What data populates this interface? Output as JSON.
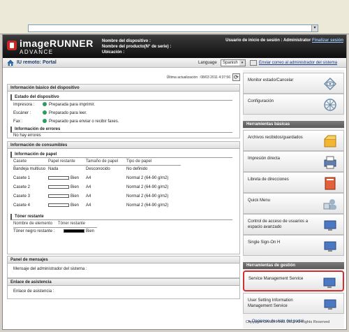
{
  "browser": {
    "address_value": "",
    "dropdown_icon": "chevron-down-icon"
  },
  "header": {
    "logo_line1": "imageRUNNER",
    "logo_line2": "ADVANCE",
    "device_name_label": "Nombre del dispositivo :",
    "product_name_label": "Nombre del producto(N° de serie) :",
    "location_label": "Ubicación :",
    "user_label": "Usuario de inicio de sesión : Administrator",
    "logout_link": "Finalizar sesión"
  },
  "toolbar": {
    "title": "IU remoto: Portal",
    "language_label": "Language",
    "language_value": "Spanish",
    "mail_link": "Enviar correo al administrador del sistema"
  },
  "main": {
    "last_update": "Última actualización : 08/03 2011 4:37:56",
    "basic_info": {
      "title": "Información básico del dispositivo",
      "status_title": "Estado del dispositivo",
      "status_rows": [
        {
          "name": "Impresora :",
          "value": "Preparada para imprimir."
        },
        {
          "name": "Escáner :",
          "value": "Preparado para leer."
        },
        {
          "name": "Fax :",
          "value": "Preparado para enviar o recibir faxes."
        }
      ],
      "errors_title": "Información de errores",
      "errors_value": "No hay errores"
    },
    "consumables": {
      "title": "Información de consumibles",
      "paper_title": "Información de papel",
      "paper_headers": [
        "Casete",
        "Papel restante",
        "Tamaño de papel",
        "Tipo de papel"
      ],
      "paper_rows": [
        {
          "cassette": "Bandeja multiuso",
          "remaining": "Nada",
          "size": "Desconocido",
          "type": "No definido"
        },
        {
          "cassette": "Casete 1",
          "remaining": "Bien",
          "size": "A4",
          "type": "Normal 2 (64-90 g/m2)"
        },
        {
          "cassette": "Casete 2",
          "remaining": "Bien",
          "size": "A4",
          "type": "Normal 2 (64-90 g/m2)"
        },
        {
          "cassette": "Casete 3",
          "remaining": "Bien",
          "size": "A4",
          "type": "Normal 2 (64-90 g/m2)"
        },
        {
          "cassette": "Casete 4",
          "remaining": "Bien",
          "size": "A4",
          "type": "Normal 2 (64-90 g/m2)"
        }
      ],
      "toner_title": "Tóner restante",
      "toner_headers": [
        "Nombre de elemento",
        "Tóner restante"
      ],
      "toner_row": {
        "name": "Tóner negro restante :",
        "value": "Bien"
      }
    },
    "messages": {
      "title": "Panel de mensajes",
      "label": "Mensaje del administrador del sistema :"
    },
    "support": {
      "title": "Enlace de asistencia",
      "label": "Enlace de asistencia :"
    }
  },
  "side": {
    "top_buttons": [
      {
        "label": "Monitor estado/Cancelar",
        "icon": "eye-icon"
      },
      {
        "label": "Configuración",
        "icon": "gear-icon"
      }
    ],
    "basic_tools_title": "Herramientas básicas",
    "basic_tools": [
      {
        "label": "Archivos recibidos/guardados",
        "icon": "box-icon"
      },
      {
        "label": "Impresión directa",
        "icon": "printer-icon"
      },
      {
        "label": "Libreta de direcciones",
        "icon": "address-book-icon"
      },
      {
        "label": "Quick Menu",
        "icon": "quick-menu-icon"
      },
      {
        "label": "Control de acceso de usuarios a espacio avanzado",
        "icon": "users-icon"
      },
      {
        "label": "Single Sign-On H",
        "icon": "monitor-icon"
      }
    ],
    "management_title": "Herramientas de gestión",
    "management_tools": [
      {
        "label": "Service Management Service",
        "icon": "monitor-icon"
      },
      {
        "label": "User Setting Information Management Service",
        "icon": "monitor-icon"
      }
    ],
    "portal_options": "Opciones de vista del portal",
    "copyright": "Copyright CANON INC. 2011 All Rights Reserved"
  }
}
